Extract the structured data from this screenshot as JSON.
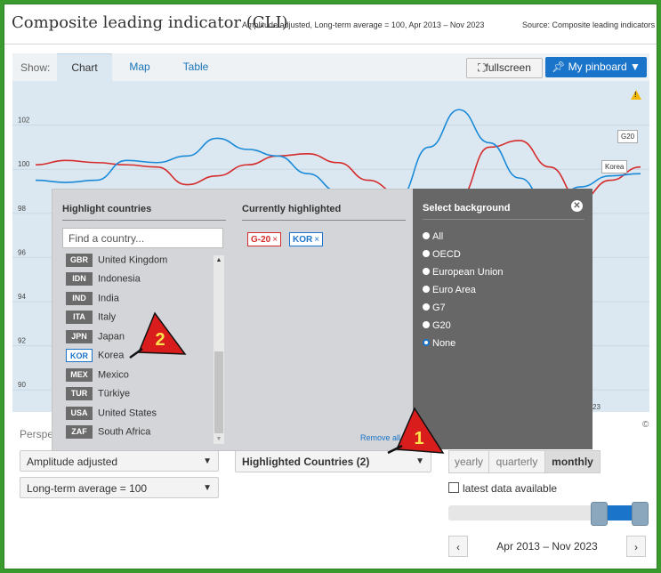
{
  "header": {
    "title": "Composite leading indicator (CLI)",
    "subtitle": "Amplitude adjusted, Long-term average = 100, Apr 2013 – Nov 2023",
    "source": "Source: Composite leading indicators"
  },
  "toolbar": {
    "show_label": "Show:",
    "tabs": [
      "Chart",
      "Map",
      "Table"
    ],
    "fullscreen_label": "fullscreen",
    "pinboard_label": "My pinboard"
  },
  "chart_data": {
    "type": "line",
    "title": "",
    "xlabel": "",
    "ylabel": "",
    "ylim": [
      89,
      104
    ],
    "y_ticks": [
      "102",
      "100",
      "98",
      "96",
      "94",
      "92",
      "90"
    ],
    "x_visible_tick_fragment": "23",
    "series": [
      {
        "name": "G20",
        "color": "#d52b2b",
        "values": [
          100.2,
          100.4,
          100.3,
          100.2,
          100.1,
          99.3,
          99.7,
          100.2,
          100.6,
          100.7,
          100.3,
          99.5,
          98.9,
          98.6,
          98.7,
          101.0,
          101.3,
          100.1,
          98.6,
          99.5,
          100.1
        ]
      },
      {
        "name": "Korea",
        "color": "#1a8ad8",
        "values": [
          99.5,
          99.4,
          99.5,
          100.4,
          100.3,
          100.6,
          101.4,
          100.9,
          100.6,
          99.8,
          99.0,
          98.6,
          98.7,
          101.0,
          102.7,
          101.2,
          99.6,
          98.2,
          99.2,
          99.7,
          99.8
        ]
      }
    ]
  },
  "bottom": {
    "perspective_label": "Perspe",
    "dropdown_amplitude": "Amplitude adjusted",
    "dropdown_average": "Long-term average = 100",
    "highlighted_countries": "Highlighted Countries (2)",
    "frequency": [
      "yearly",
      "quarterly",
      "monthly"
    ],
    "latest_label": "latest data available",
    "date_range": "Apr 2013 – Nov 2023",
    "copyright": "©"
  },
  "highlight_panel": {
    "title": "Highlight countries",
    "search_placeholder": "Find a country...",
    "countries": [
      {
        "code": "GBR",
        "name": "United Kingdom"
      },
      {
        "code": "IDN",
        "name": "Indonesia"
      },
      {
        "code": "IND",
        "name": "India"
      },
      {
        "code": "ITA",
        "name": "Italy"
      },
      {
        "code": "JPN",
        "name": "Japan"
      },
      {
        "code": "KOR",
        "name": "Korea"
      },
      {
        "code": "MEX",
        "name": "Mexico"
      },
      {
        "code": "TUR",
        "name": "Türkiye"
      },
      {
        "code": "USA",
        "name": "United States"
      },
      {
        "code": "ZAF",
        "name": "South Africa"
      }
    ],
    "selected_code": "KOR",
    "currently_title": "Currently highlighted",
    "chips": [
      {
        "label": "G-20",
        "color": "red"
      },
      {
        "label": "KOR",
        "color": "blue"
      }
    ],
    "remove_all": "Remove all"
  },
  "background_panel": {
    "title": "Select background",
    "options": [
      "All",
      "OECD",
      "European Union",
      "Euro Area",
      "G7",
      "G20",
      "None"
    ],
    "selected": "None"
  },
  "markers": {
    "one": "1",
    "two": "2"
  },
  "icons": {
    "warning": "warning-icon",
    "fullscreen": "fullscreen-icon",
    "pin": "pin-icon",
    "close": "close-icon",
    "chevron": "chevron-down-icon"
  }
}
